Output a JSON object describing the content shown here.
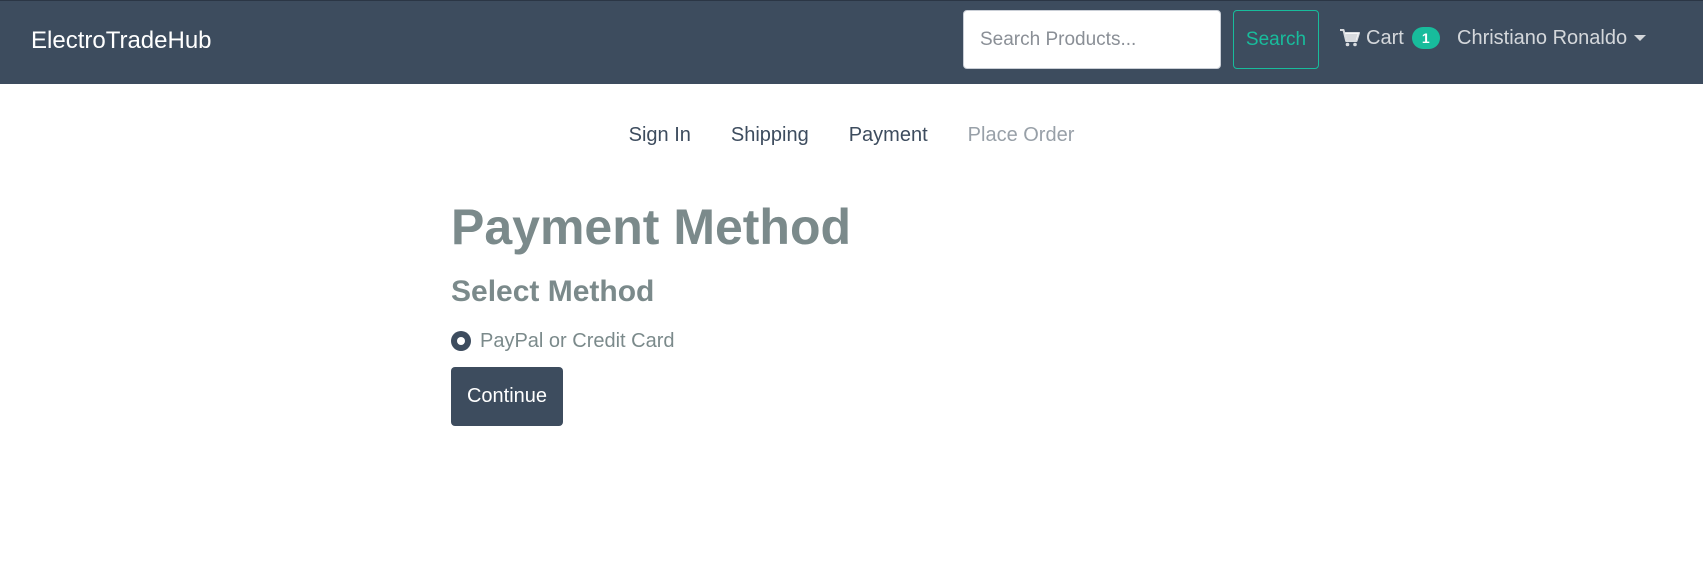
{
  "header": {
    "brand": "ElectroTradeHub",
    "search": {
      "placeholder": "Search Products...",
      "value": ""
    },
    "search_button": "Search",
    "cart": {
      "label": "Cart",
      "count": "1"
    },
    "user": {
      "name": "Christiano Ronaldo"
    }
  },
  "steps": [
    {
      "label": "Sign In",
      "enabled": true
    },
    {
      "label": "Shipping",
      "enabled": true
    },
    {
      "label": "Payment",
      "enabled": true
    },
    {
      "label": "Place Order",
      "enabled": false
    }
  ],
  "main": {
    "title": "Payment Method",
    "section_title": "Select Method",
    "payment_option": {
      "label": "PayPal or Credit Card",
      "checked": true
    },
    "continue_button": "Continue"
  },
  "colors": {
    "navbar": "#3d4c5e",
    "accent": "#18bc9c",
    "heading": "#7b8a8b"
  }
}
